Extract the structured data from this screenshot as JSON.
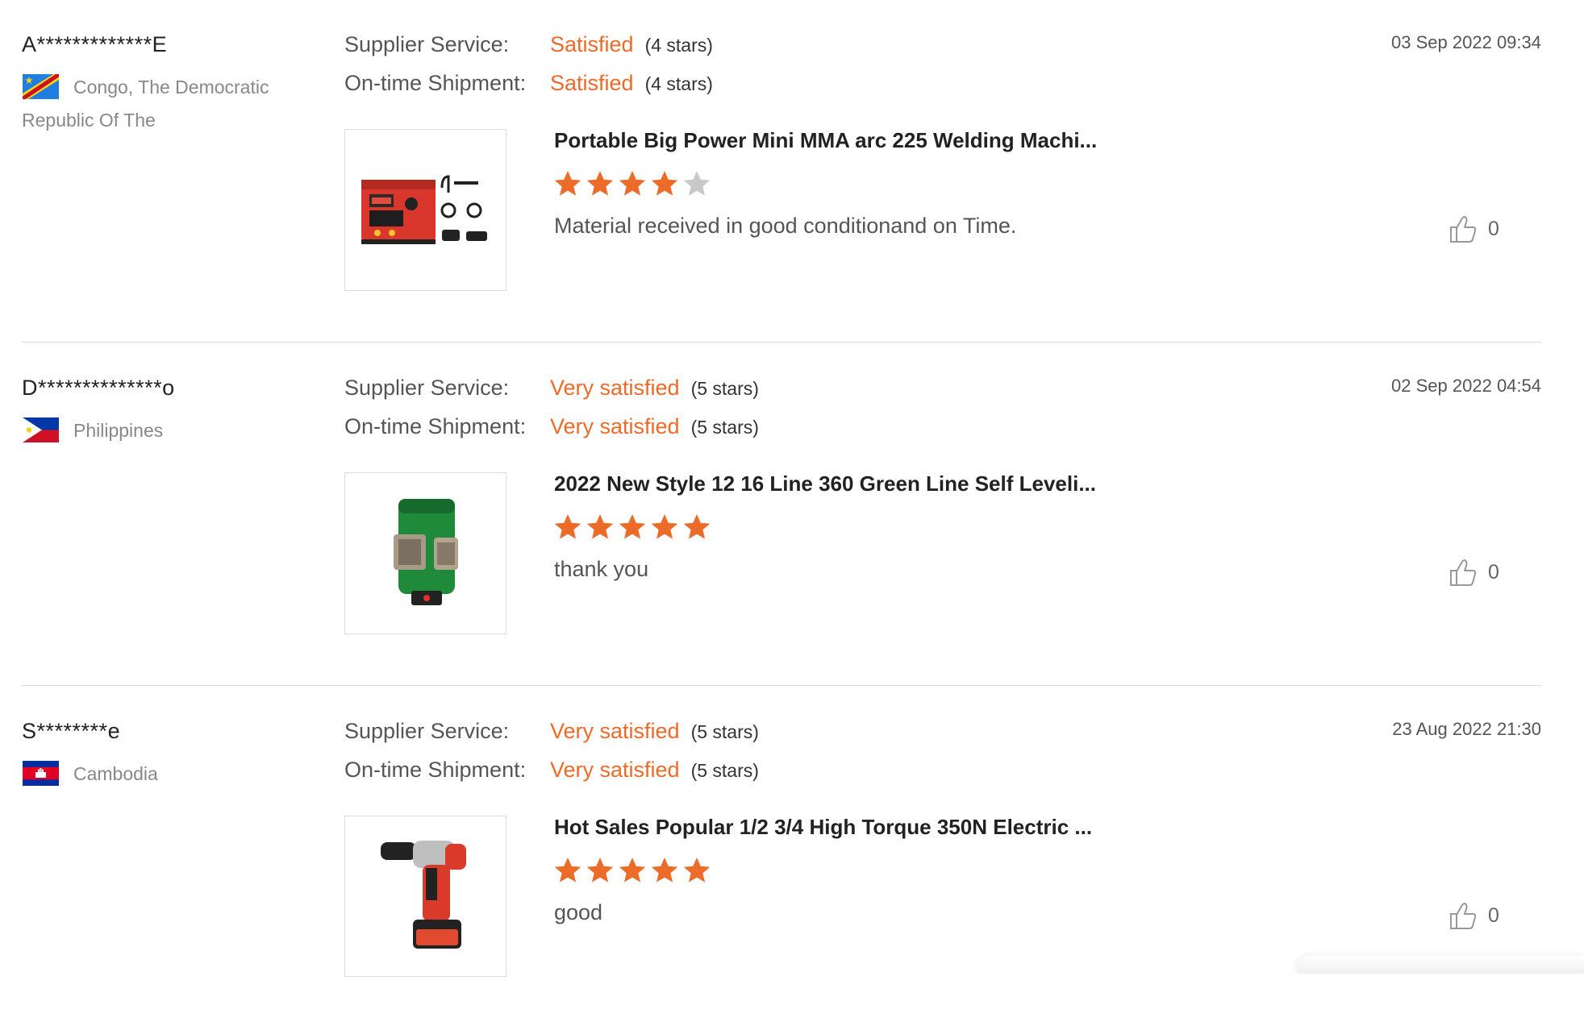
{
  "labels": {
    "supplier_service": "Supplier Service:",
    "on_time_shipment": "On-time Shipment:"
  },
  "colors": {
    "accent": "#ec6b29",
    "star_empty": "#c8c8c8",
    "divider": "#d8d8d8"
  },
  "reviews": [
    {
      "name": "A*************E",
      "country": "Congo, The Democratic Republic Of The",
      "flag": "flag-congo-drc",
      "date": "03 Sep 2022 09:34",
      "supplier_service_value": "Satisfied",
      "supplier_service_stars": "(4 stars)",
      "shipment_value": "Satisfied",
      "shipment_stars": "(4 stars)",
      "product_title": "Portable Big Power Mini MMA arc 225 Welding Machi...",
      "product_image": "welding-machine-image",
      "rating": 4,
      "comment": "Material received in good conditionand on Time.",
      "likes": "0"
    },
    {
      "name": "D**************o",
      "country": "Philippines",
      "flag": "flag-philippines",
      "date": "02 Sep 2022 04:54",
      "supplier_service_value": "Very satisfied",
      "supplier_service_stars": "(5 stars)",
      "shipment_value": "Very satisfied",
      "shipment_stars": "(5 stars)",
      "product_title": "2022 New Style 12 16 Line 360 Green Line Self Leveli...",
      "product_image": "laser-level-image",
      "rating": 5,
      "comment": "thank you",
      "likes": "0"
    },
    {
      "name": "S********e",
      "country": "Cambodia",
      "flag": "flag-cambodia",
      "date": "23 Aug 2022 21:30",
      "supplier_service_value": "Very satisfied",
      "supplier_service_stars": "(5 stars)",
      "shipment_value": "Very satisfied",
      "shipment_stars": "(5 stars)",
      "product_title": "Hot Sales Popular 1/2 3/4 High Torque 350N Electric ...",
      "product_image": "impact-wrench-image",
      "rating": 5,
      "comment": "good",
      "likes": "0"
    }
  ]
}
